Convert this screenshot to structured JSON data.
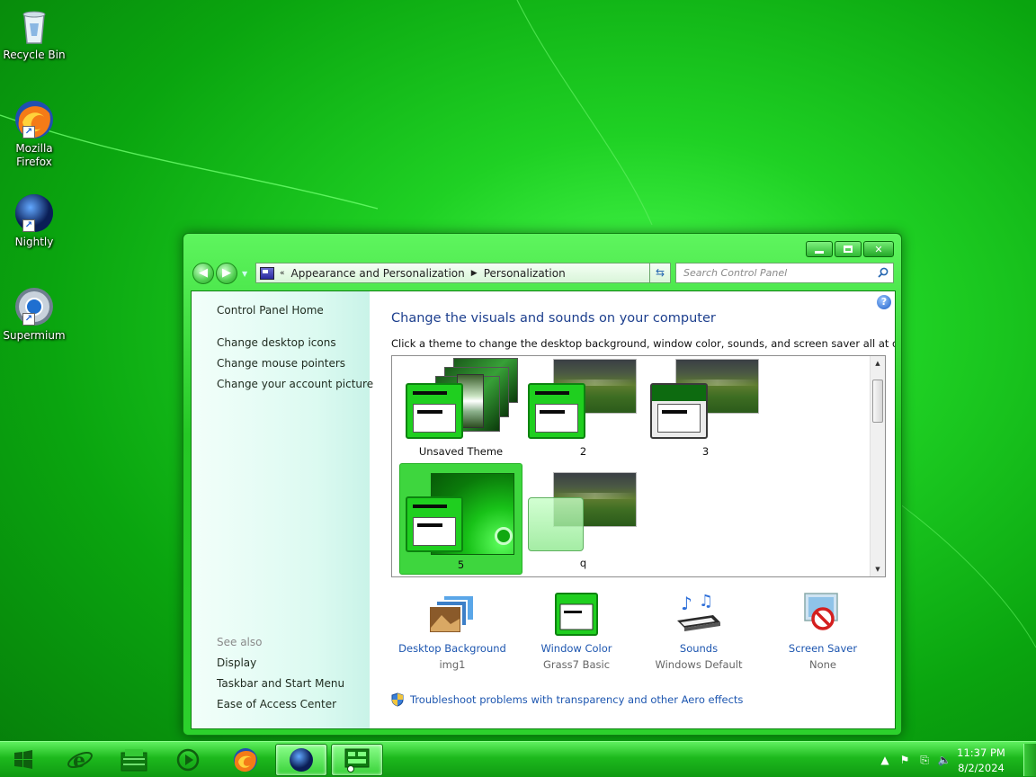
{
  "desktop": {
    "icons": [
      {
        "label": "Recycle Bin"
      },
      {
        "label": "Mozilla\nFirefox"
      },
      {
        "label": "Nightly"
      },
      {
        "label": "Supermium"
      }
    ]
  },
  "window": {
    "breadcrumb": [
      "Appearance and Personalization",
      "Personalization"
    ],
    "search_placeholder": "Search Control Panel",
    "help_glyph": "?",
    "left_pane": {
      "links": [
        "Control Panel Home",
        "Change desktop icons",
        "Change mouse pointers",
        "Change your account picture"
      ],
      "see_also_heading": "See also",
      "see_also_links": [
        "Display",
        "Taskbar and Start Menu",
        "Ease of Access Center"
      ]
    },
    "main": {
      "title": "Change the visuals and sounds on your computer",
      "description": "Click a theme to change the desktop background, window color, sounds, and screen saver all at once.",
      "themes": [
        {
          "name": "Unsaved Theme"
        },
        {
          "name": "2"
        },
        {
          "name": "3"
        },
        {
          "name": "5"
        },
        {
          "name": "q"
        }
      ],
      "selected_theme": "5",
      "settings": [
        {
          "label": "Desktop Background",
          "value": "img1"
        },
        {
          "label": "Window Color",
          "value": "Grass7 Basic"
        },
        {
          "label": "Sounds",
          "value": "Windows Default"
        },
        {
          "label": "Screen Saver",
          "value": "None"
        }
      ],
      "troubleshoot_link": "Troubleshoot problems with transparency and other Aero effects"
    }
  },
  "taskbar": {
    "clock_time": "11:37 PM",
    "clock_date": "8/2/2024"
  },
  "colors": {
    "accent_green": "#2fd32f",
    "link_blue": "#1d56b0",
    "title_blue": "#1d3f8e"
  }
}
